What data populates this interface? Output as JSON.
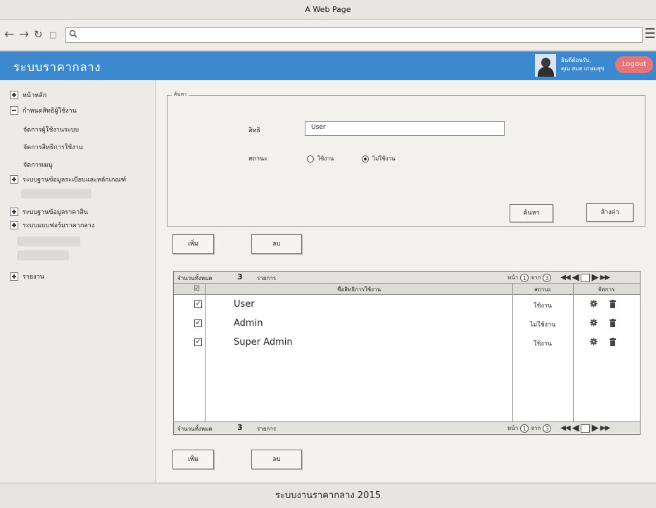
{
  "browser": {
    "window_title": "A Web Page",
    "url": ""
  },
  "header": {
    "app_title": "ระบบราคากลาง",
    "welcome_line1": "ยินดีต้อนรับ,",
    "welcome_line2": "คุณ สมส เกษมสุข",
    "logout_label": "Logout",
    "color": "#3d89cf",
    "logout_color": "#e5757a"
  },
  "sidebar": {
    "items": [
      {
        "label": "หน้าหลัก",
        "icon": "plus-box-icon"
      },
      {
        "label": "กำหนดสิทธิผู้ใช้งาน",
        "icon": "minus-box-icon"
      },
      {
        "label": "จัดการผู้ใช้งานระบบ"
      },
      {
        "label": "จัดการสิทธิการใช้งาน"
      },
      {
        "label": "จัดการเมนู"
      },
      {
        "label": "ระบบฐานข้อมูลระเบียบและหลักเกณฑ์",
        "icon": "plus-box-icon"
      },
      {
        "label": "ระบบฐานข้อมูลราคาสิน",
        "icon": "plus-box-icon"
      },
      {
        "label": "ระบบแบบฟอร์มราคากลาง",
        "icon": "plus-box-icon"
      },
      {
        "label": "รายงาน",
        "icon": "plus-box-icon"
      }
    ]
  },
  "search": {
    "legend": "ค้นหา",
    "role_label": "สิทธิ",
    "role_value": "User",
    "status_label": "สถานะ",
    "status_options": [
      {
        "label": "ใช้งาน",
        "selected": false
      },
      {
        "label": "ไม่ใช้งาน",
        "selected": true
      }
    ],
    "search_button": "ค้นหา",
    "clear_button": "ล้างค่า"
  },
  "actions": {
    "add_label": "เพิ่ม",
    "delete_label": "ลบ"
  },
  "grid": {
    "total_label": "จำนวนทั้งหมด",
    "total_count": "3",
    "total_unit": "รายการ",
    "pager": {
      "page_prefix": "หน้า",
      "page": "1",
      "of_label": "จาก",
      "page_count": "3"
    },
    "columns": {
      "check": "☑",
      "name": "ชื่อสิทธิการใช้งาน",
      "status": "สถานะ",
      "manage": "จัดการ"
    },
    "rows": [
      {
        "name": "User",
        "status": "ใช้งาน",
        "checked": true
      },
      {
        "name": "Admin",
        "status": "ไม่ใช้งาน",
        "checked": true
      },
      {
        "name": "Super Admin",
        "status": "ใช้งาน",
        "checked": true
      }
    ]
  },
  "footer": {
    "text": "ระบบงานราคากลาง 2015"
  }
}
